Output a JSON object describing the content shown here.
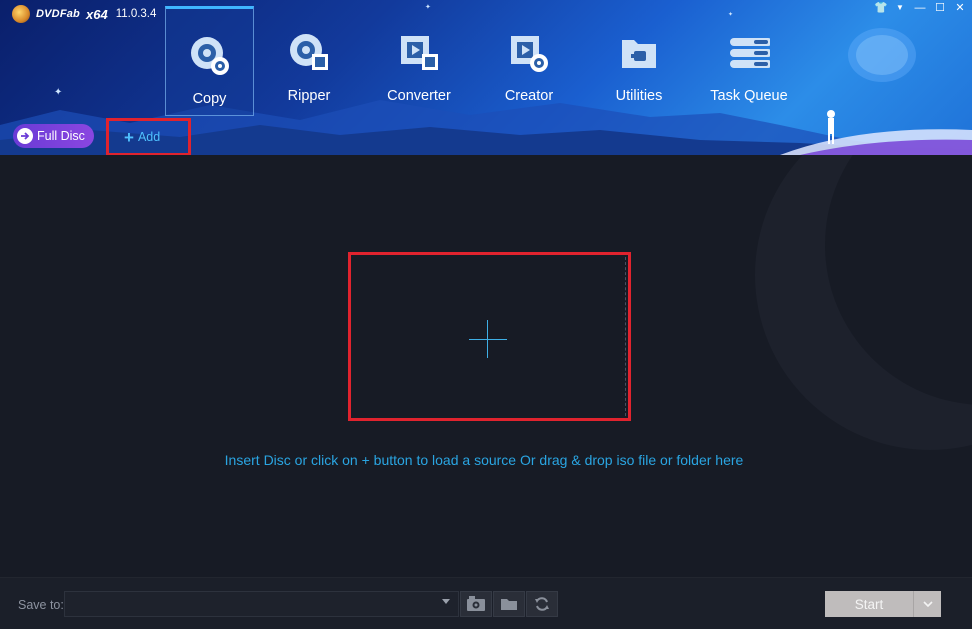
{
  "app": {
    "brand": "DVDFab",
    "arch": "x64",
    "version": "11.0.3.4"
  },
  "window_controls": [
    {
      "name": "skin",
      "glyph": "👕"
    },
    {
      "name": "menu",
      "glyph": "▼"
    },
    {
      "name": "minimize",
      "glyph": "—"
    },
    {
      "name": "maximize",
      "glyph": "☐"
    },
    {
      "name": "close",
      "glyph": "✕"
    }
  ],
  "nav": {
    "items": [
      {
        "label": "Copy",
        "icon": "copy-disc-icon",
        "active": true
      },
      {
        "label": "Ripper",
        "icon": "ripper-disc-film-icon",
        "active": false
      },
      {
        "label": "Converter",
        "icon": "converter-film-icon",
        "active": false
      },
      {
        "label": "Creator",
        "icon": "creator-film-disc-icon",
        "active": false
      },
      {
        "label": "Utilities",
        "icon": "utilities-folder-icon",
        "active": false
      },
      {
        "label": "Task Queue",
        "icon": "task-queue-list-icon",
        "active": false
      }
    ]
  },
  "toolbar": {
    "full_disc_label": "Full Disc",
    "add_label": "Add"
  },
  "main": {
    "hint": "Insert Disc or click on + button to load a source Or drag & drop iso file or folder here"
  },
  "bottom": {
    "save_to_label": "Save to:",
    "save_to_value": "",
    "start_label": "Start"
  },
  "colors": {
    "accent": "#3fb6ff",
    "highlight_border": "#e0232e",
    "hint_text": "#2aa5e2",
    "full_disc_bg": "#7a40dc",
    "start_bg": "#bfbcbc"
  }
}
